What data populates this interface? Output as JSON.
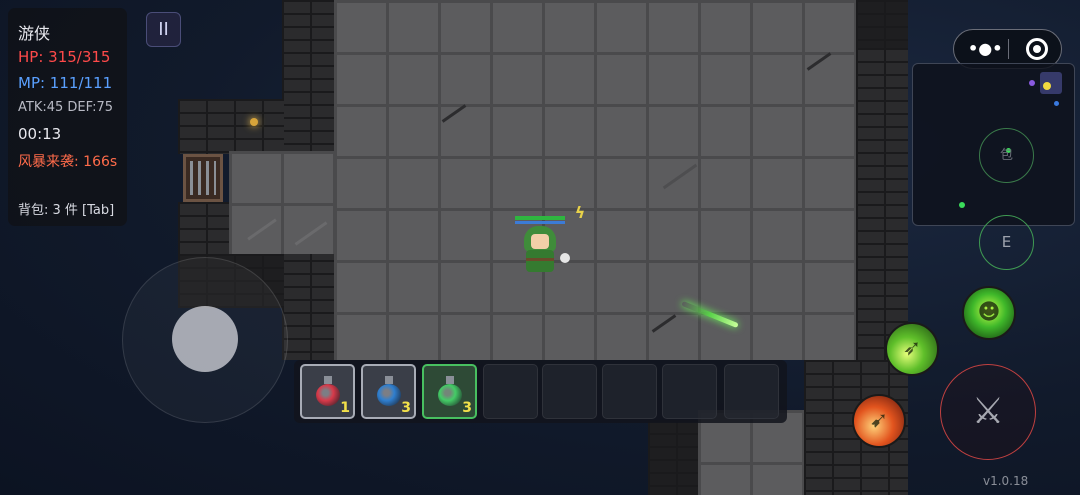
{
  "hud": {
    "class_name": "游侠",
    "hp": "HP: 315/315",
    "mp": "MP: 111/111",
    "atk_def": "ATK:45 DEF:75",
    "timer": "00:13",
    "storm": "风暴来袭: 166s",
    "inventory": "背包: 3 件 [Tab]"
  },
  "pause_label": "II",
  "hotbar": [
    {
      "item": "red-potion",
      "color": "#d83a4a",
      "qty": "1"
    },
    {
      "item": "blue-potion",
      "color": "#2f7fd0",
      "qty": "3"
    },
    {
      "item": "green-potion",
      "color": "#44cc66",
      "qty": "3"
    }
  ],
  "system": {
    "menu_icon": "•●•"
  },
  "buttons": {
    "bag": "包",
    "interact": "E",
    "attack_icon": "crossed-swords-icon",
    "attack_glyph": "⚔"
  },
  "player": {
    "hp_fraction": 1.0,
    "mp_fraction": 1.0
  },
  "version": "v1.0.18",
  "colors": {
    "hp": "#ff4a4a",
    "mp": "#5aa0ff",
    "storm": "#ff6b4a",
    "text": "#e8e8ee"
  }
}
